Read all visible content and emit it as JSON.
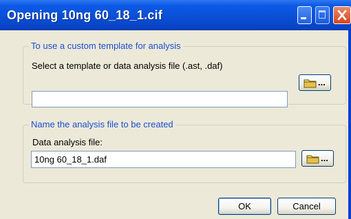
{
  "window": {
    "title": "Opening 10ng 60_18_1.cif",
    "controls": [
      "minimize-icon",
      "maximize-icon",
      "close-icon"
    ]
  },
  "template_group": {
    "legend": "To use a custom template for analysis",
    "caption": "Select a template or data analysis file (.ast, .daf)",
    "path_value": "",
    "browse_label": "..."
  },
  "analysis_group": {
    "legend": "Name the analysis file to be created",
    "caption": "Data analysis file:",
    "file_value": "10ng 60_18_1.daf",
    "browse_label": "..."
  },
  "buttons": {
    "ok": "OK",
    "cancel": "Cancel"
  },
  "colors": {
    "titlebar": "#0a4fd6",
    "legend_text": "#1c4fd0",
    "dialog_face": "#ece9d8",
    "close_button": "#d6451b"
  }
}
